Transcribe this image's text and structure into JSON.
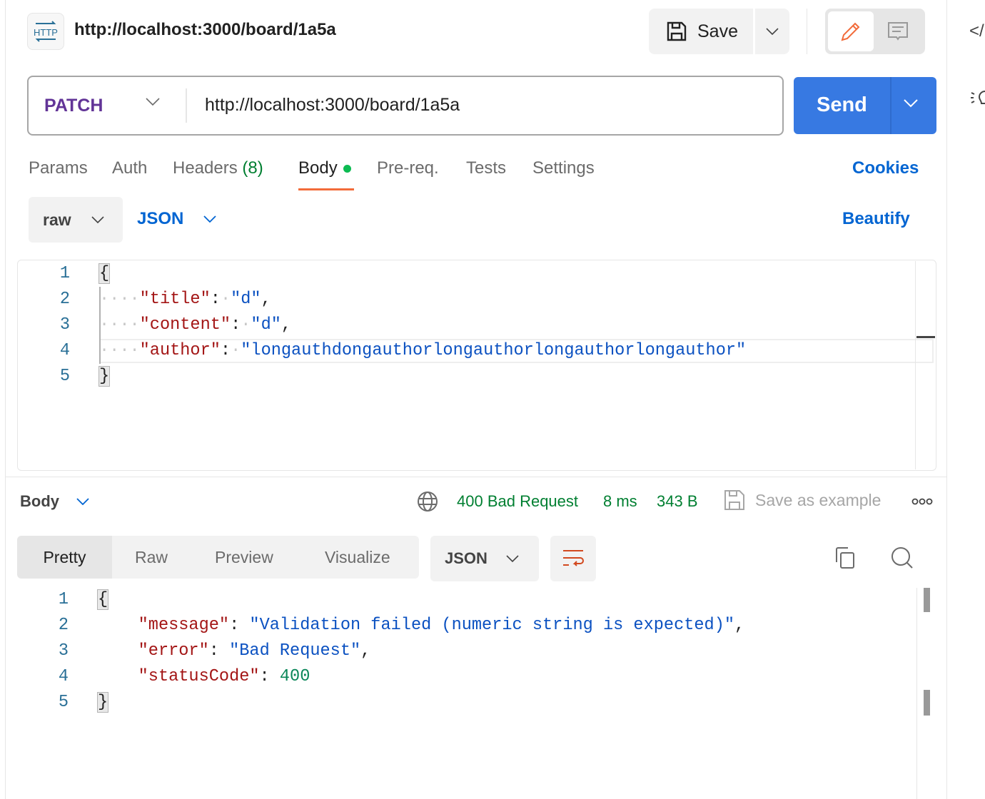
{
  "header": {
    "title": "http://localhost:3000/board/1a5a",
    "icon": "http-icon",
    "save_label": "Save"
  },
  "request": {
    "method": "PATCH",
    "url": "http://localhost:3000/board/1a5a",
    "send_label": "Send",
    "method_color": "#623497",
    "send_color": "#3779e2"
  },
  "tabs": [
    {
      "label": "Params"
    },
    {
      "label": "Auth"
    },
    {
      "label": "Headers",
      "count": "(8)"
    },
    {
      "label": "Body",
      "active": true
    },
    {
      "label": "Pre-req."
    },
    {
      "label": "Tests"
    },
    {
      "label": "Settings"
    }
  ],
  "cookies_label": "Cookies",
  "body_mode": {
    "mode": "raw",
    "format": "JSON",
    "beautify_label": "Beautify"
  },
  "request_body": {
    "lines": [
      "1",
      "2",
      "3",
      "4",
      "5"
    ],
    "open": "{",
    "close": "}",
    "k1": "\"title\"",
    "v1": "\"d\"",
    "k2": "\"content\"",
    "v2": "\"d\"",
    "k3": "\"author\"",
    "v3": "\"longauthdongauthorlongauthorlongauthorlongauthor\""
  },
  "response": {
    "section_label": "Body",
    "status": "400 Bad Request",
    "time": "8 ms",
    "size": "343 B",
    "save_example_label": "Save as example",
    "view_tabs": [
      "Pretty",
      "Raw",
      "Preview",
      "Visualize"
    ],
    "format": "JSON",
    "lines": [
      "1",
      "2",
      "3",
      "4",
      "5"
    ],
    "k1": "\"message\"",
    "v1": "\"Validation failed (numeric string is expected)\"",
    "k2": "\"error\"",
    "v2": "\"Bad Request\"",
    "k3": "\"statusCode\"",
    "v3": "400"
  }
}
